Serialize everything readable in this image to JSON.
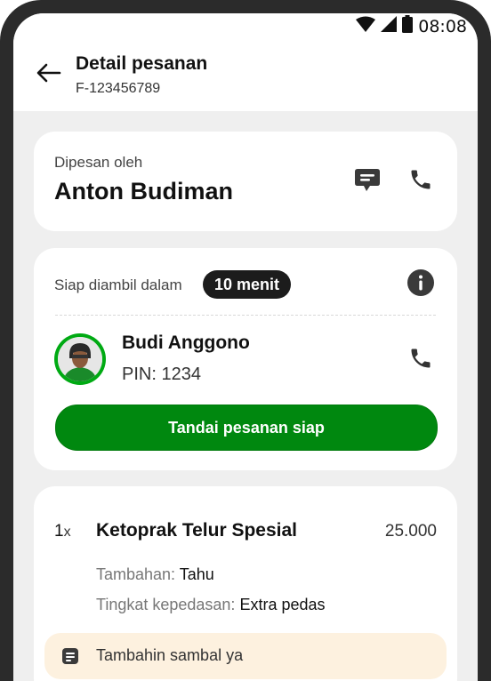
{
  "status_bar": {
    "time": "08:08"
  },
  "header": {
    "title": "Detail pesanan",
    "order_id": "F-123456789"
  },
  "customer": {
    "label": "Dipesan oleh",
    "name": "Anton Budiman"
  },
  "pickup": {
    "ready_label": "Siap diambil dalam",
    "ready_badge": "10 menit",
    "driver_name": "Budi Anggono",
    "driver_pin": "PIN: 1234",
    "mark_ready_button": "Tandai pesanan siap"
  },
  "order_item": {
    "quantity": "1",
    "quantity_suffix": "x",
    "name": "Ketoprak Telur Spesial",
    "price": "25.000",
    "addons": [
      {
        "label": "Tambahan:",
        "value": "Tahu"
      },
      {
        "label": "Tingkat kepedasan:",
        "value": "Extra pedas"
      }
    ],
    "note": "Tambahin sambal ya"
  },
  "colors": {
    "primary_green": "#00880f",
    "badge_bg": "#1c1c1c",
    "note_bg": "#fdf1df"
  },
  "icons": {
    "back": "arrow-left-icon",
    "chat": "chat-bubble-icon",
    "phone": "phone-icon",
    "info": "info-icon",
    "note": "note-icon"
  }
}
